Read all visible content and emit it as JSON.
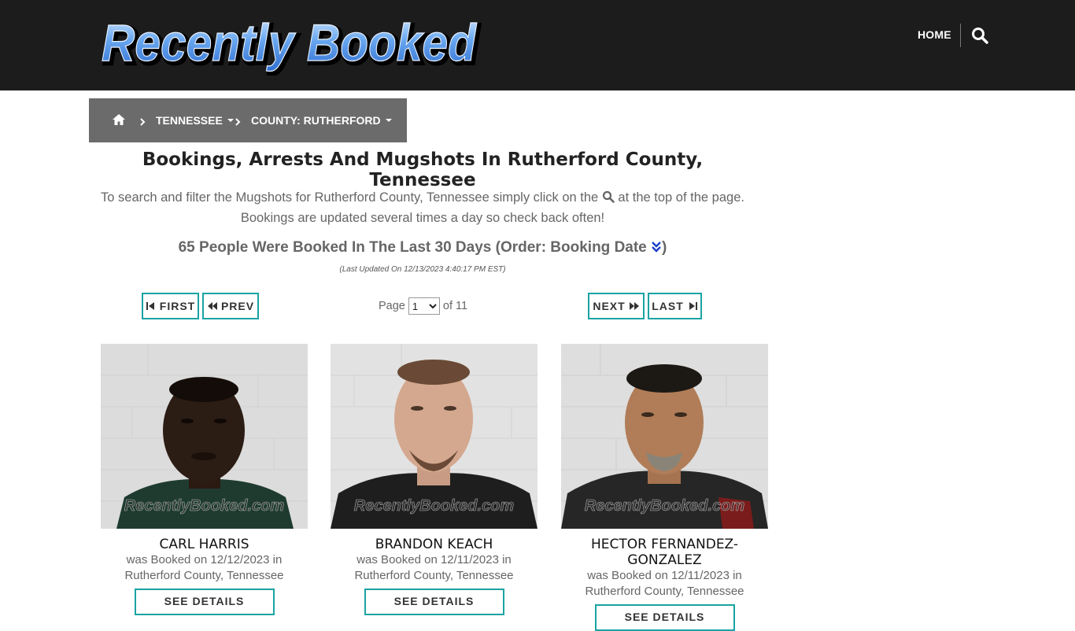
{
  "site": {
    "logo_text": "Recently Booked",
    "nav_home": "HOME",
    "search_icon": "search-icon"
  },
  "breadcrumb": {
    "home_icon": "home-icon",
    "state": "TENNESSEE",
    "county": "COUNTY: RUTHERFORD"
  },
  "main": {
    "title": "Bookings, Arrests And Mugshots In Rutherford County, Tennessee",
    "intro_before": "To search and filter the Mugshots for Rutherford County, Tennessee simply click on the",
    "intro_after": "at the top of the page.",
    "intro_line2": "Bookings are updated several times a day so check back often!",
    "count_text": "65 People Were Booked In The Last 30 Days (Order: Booking Date",
    "count_close": ")",
    "updated": "(Last Updated On 12/13/2023 4:40:17 PM EST)"
  },
  "pagination": {
    "first": "FIRST",
    "prev": "PREV",
    "next": "NEXT",
    "last": "LAST",
    "page_label": "Page",
    "current_page": "1",
    "of_label": "of 11"
  },
  "cards": [
    {
      "name": "CARL HARRIS",
      "booked": "was Booked on 12/12/2023 in",
      "location": "Rutherford County, Tennessee",
      "watermark": "RecentlyBooked.com",
      "details": "SEE DETAILS"
    },
    {
      "name": "BRANDON KEACH",
      "booked": "was Booked on 12/11/2023 in",
      "location": "Rutherford County, Tennessee",
      "watermark": "RecentlyBooked.com",
      "details": "SEE DETAILS"
    },
    {
      "name": "HECTOR FERNANDEZ-GONZALEZ",
      "name_line1": "HECTOR FERNANDEZ-",
      "name_line2": "GONZALEZ",
      "booked": "was Booked on 12/11/2023 in",
      "location": "Rutherford County, Tennessee",
      "watermark": "RecentlyBooked.com",
      "details": "SEE DETAILS"
    }
  ],
  "colors": {
    "header_bg": "#1c1c1c",
    "breadcrumb_bg": "#6b6b6b",
    "accent_teal": "#1aa3a3",
    "logo_blue": "#5b9ae8"
  }
}
